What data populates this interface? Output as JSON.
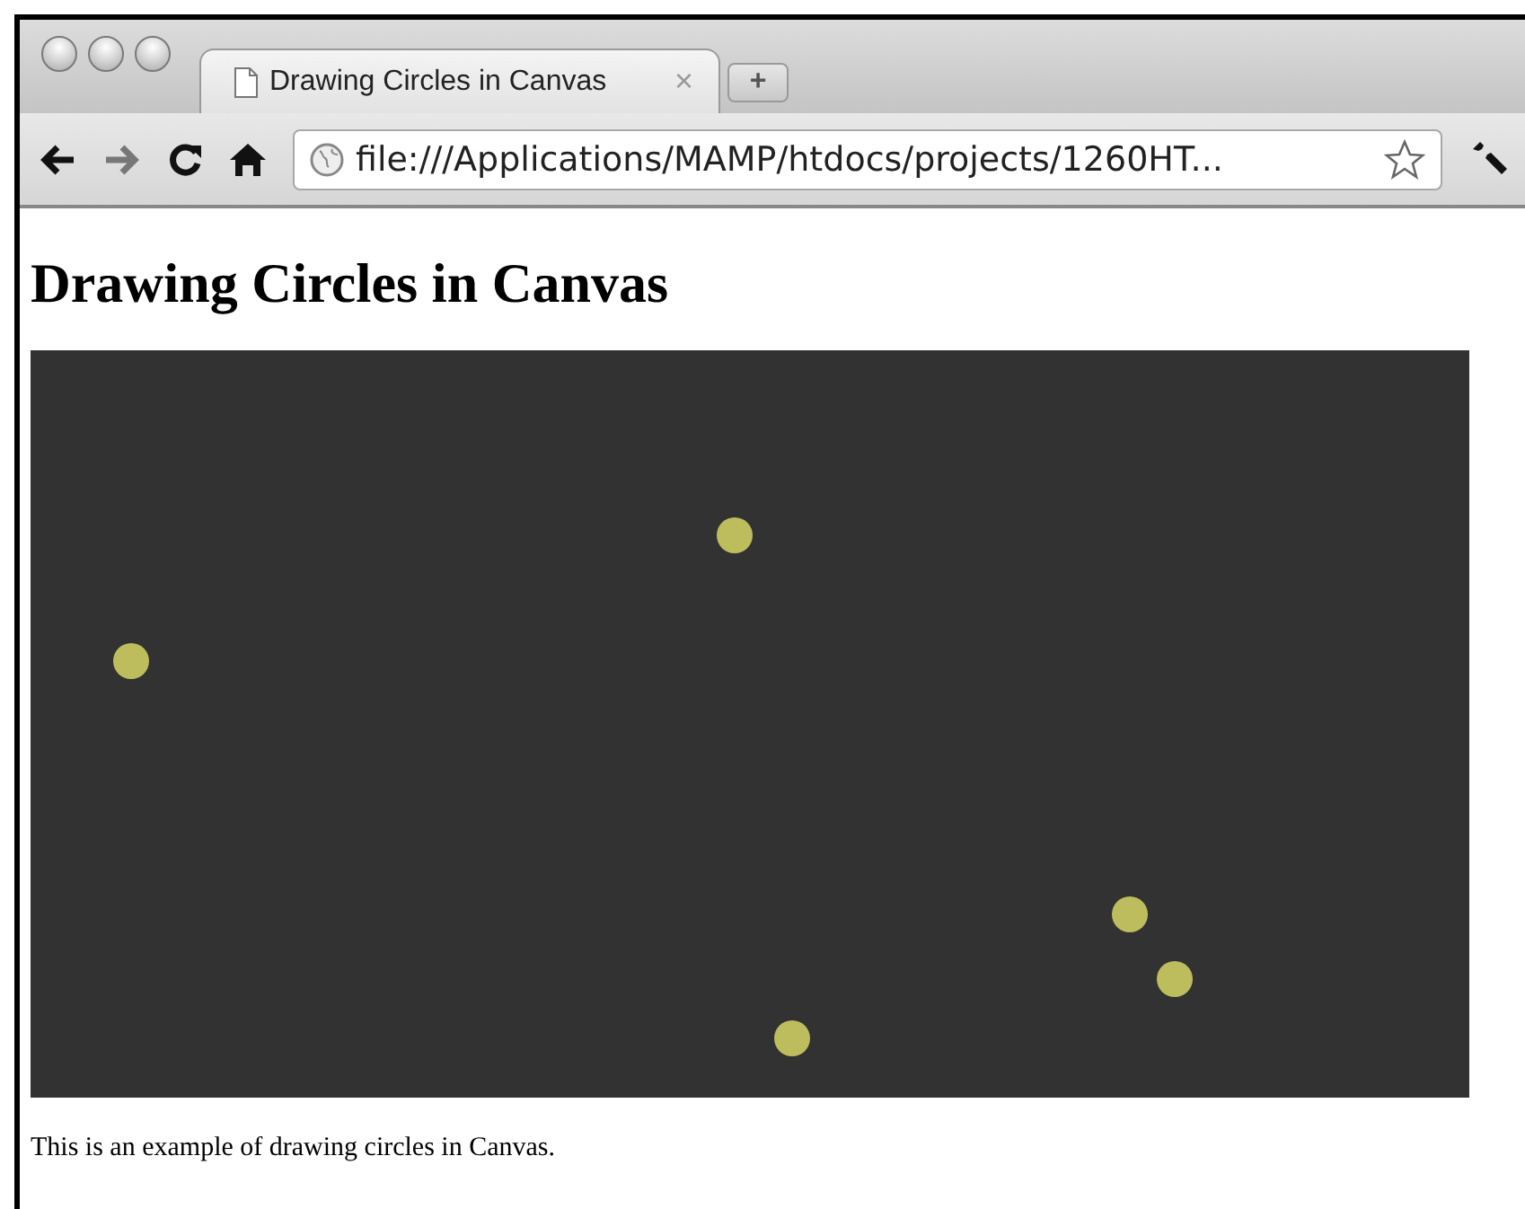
{
  "tab": {
    "title": "Drawing Circles in Canvas",
    "close": "×",
    "new_tab": "+"
  },
  "address_bar": {
    "url": "file:///Applications/MAMP/htdocs/projects/1260HT..."
  },
  "page": {
    "heading": "Drawing Circles in Canvas",
    "paragraph": "This is an example of drawing circles in Canvas."
  }
}
